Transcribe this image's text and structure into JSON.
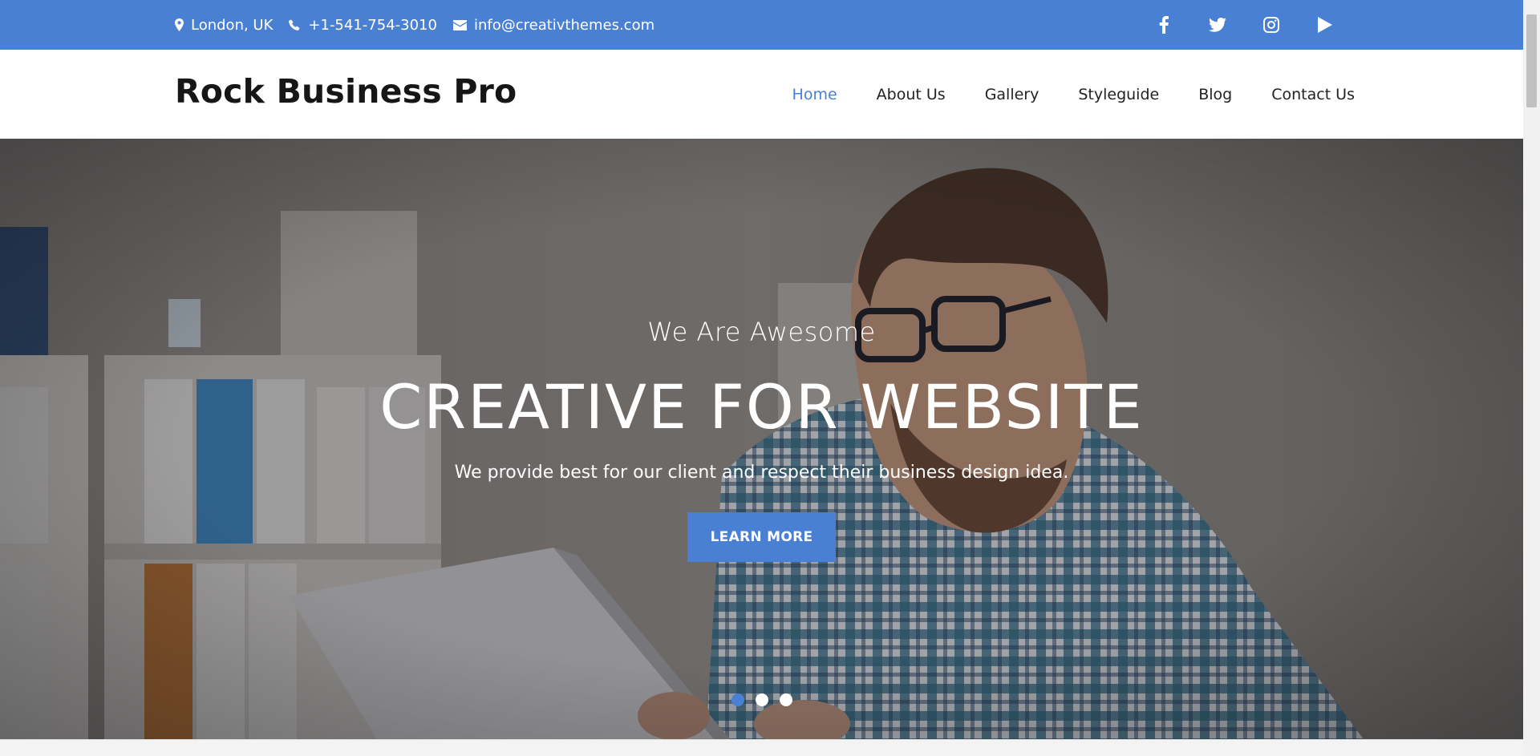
{
  "topbar": {
    "location": "London, UK",
    "phone": "+1-541-754-3010",
    "email": "info@creativthemes.com",
    "social": [
      "facebook-icon",
      "twitter-icon",
      "instagram-icon",
      "youtube-icon"
    ],
    "color": "#4a80d4"
  },
  "header": {
    "logo": "Rock Business Pro",
    "nav": [
      {
        "label": "Home",
        "active": true
      },
      {
        "label": "About Us"
      },
      {
        "label": "Gallery"
      },
      {
        "label": "Styleguide"
      },
      {
        "label": "Blog"
      },
      {
        "label": "Contact Us"
      }
    ]
  },
  "hero": {
    "subtitle": "We Are Awesome",
    "title": "CREATIVE FOR WEBSITE",
    "description": "We provide best for our client and respect their business design idea.",
    "button": "LEARN MORE",
    "slides": 3,
    "active_slide": 1
  }
}
